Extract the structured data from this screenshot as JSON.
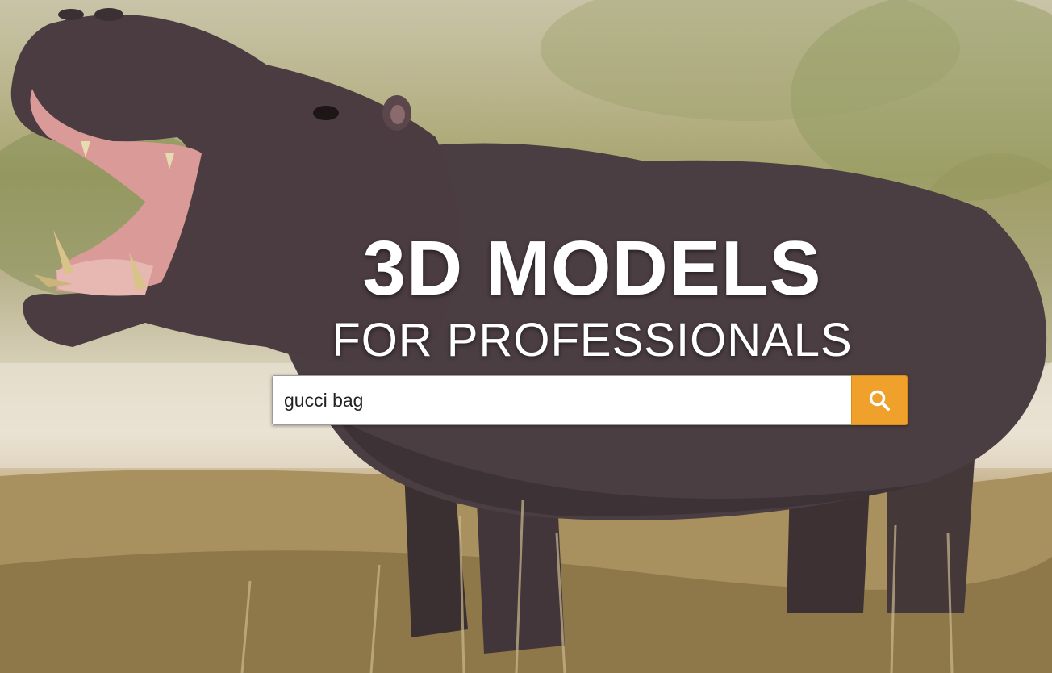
{
  "hero": {
    "headline_main": "3D MODELS",
    "headline_sub": "FOR PROFESSIONALS",
    "image_subject": "hippopotamus-photo"
  },
  "search": {
    "value": "gucci bag",
    "button_icon": "search-icon",
    "button_color": "#f0a12c"
  }
}
